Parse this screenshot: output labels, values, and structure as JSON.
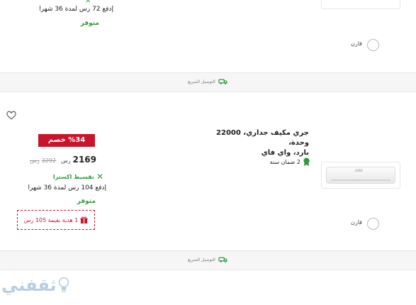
{
  "product1": {
    "installment_text": "إدفع 72 رس لمدة 36 شهرا",
    "availability": "متوفر",
    "compare_label": "قارن"
  },
  "fast_delivery_label": "التوصيل السريع",
  "product2": {
    "title_line1": "جري مكيف جداري، 22000 وحدة،",
    "title_line2": "بارد، واي فاي",
    "discount_badge": "%34 خصم",
    "price": "2169",
    "currency": "رس",
    "old_price": "3292",
    "old_currency": "رس",
    "installment_brand": "تقسيط اكسترا",
    "installment_text": "إدفع 104 رس لمدة 36 شهرا",
    "availability": "متوفر",
    "gift_text": "1 هدية بقيمة 105 رس",
    "warranty": "2 ضمان سنة",
    "compare_label": "قارن",
    "brand_logo_text": "GREE"
  },
  "watermark": "ثقفني",
  "colors": {
    "accent_red": "#c9142b",
    "available_green": "#2e9a3a"
  }
}
